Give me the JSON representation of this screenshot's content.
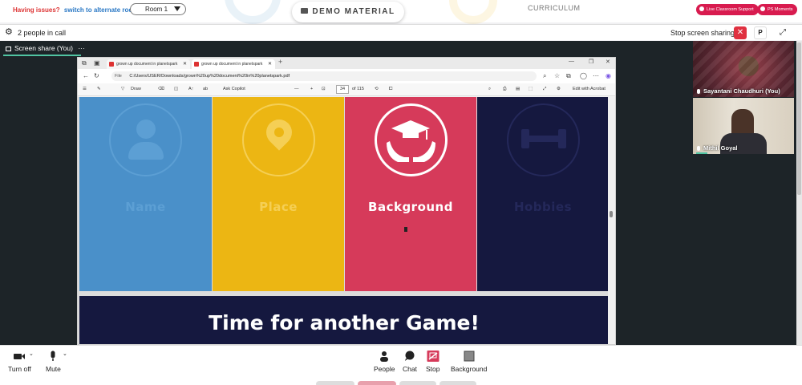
{
  "topbar": {
    "issues_text": "Having issues?",
    "alt_room_link": "switch to alternate room",
    "room_selected": "Room 1",
    "demo_material_label": "DEMO MATERIAL",
    "curriculum_label": "CURRICULUM",
    "live_support_label": "Live Classroom Support",
    "ps_moments_label": "PS Moments"
  },
  "callbar": {
    "people_count": "2 people in call",
    "stop_sharing_label": "Stop screen sharing",
    "close_glyph": "✕",
    "p_glyph": "P",
    "expand_glyph": "⤢"
  },
  "stage": {
    "share_label": "Screen share (You)",
    "more_glyph": "···"
  },
  "participants": [
    {
      "name": "Sayantani Chaudhuri (You)"
    },
    {
      "name": "Mithil Goyal"
    }
  ],
  "browser": {
    "tabs": [
      {
        "label": "grown up document in planetspark"
      },
      {
        "label": "grown up document in planetspark"
      }
    ],
    "new_tab_glyph": "+",
    "window_controls": [
      "—",
      "❐",
      "✕"
    ],
    "file_label": "File",
    "url": "C:/Users/USER/Downloads/grown%20up%20document%20in%20planetspark.pdf",
    "pdf_toolbar": {
      "draw_label": "Draw",
      "ask_copilot_label": "Ask Copilot",
      "zoom_minus": "—",
      "zoom_plus": "+",
      "page_number": "34",
      "page_total": "of 115",
      "edit_acrobat_label": "Edit with Acrobat"
    }
  },
  "slides": {
    "panels": [
      {
        "label": "Name",
        "bg": "#4a90c9",
        "fg": "#5c9fd4"
      },
      {
        "label": "Place",
        "bg": "#ecb613",
        "fg": "#f5cf55"
      },
      {
        "label": "Background",
        "bg": "#d63a5a",
        "fg": "#ffffff"
      },
      {
        "label": "Hobbies",
        "bg": "#15183f",
        "fg": "#24285a"
      }
    ],
    "game_title": "Time for another Game!"
  },
  "bottombar": {
    "turn_off_label": "Turn off",
    "mute_label": "Mute",
    "people_label": "People",
    "chat_label": "Chat",
    "stop_label": "Stop",
    "background_label": "Background"
  },
  "colors": {
    "accent_red": "#d81b4f",
    "share_underline": "#50c4a2",
    "stage_bg": "#1d2428"
  }
}
